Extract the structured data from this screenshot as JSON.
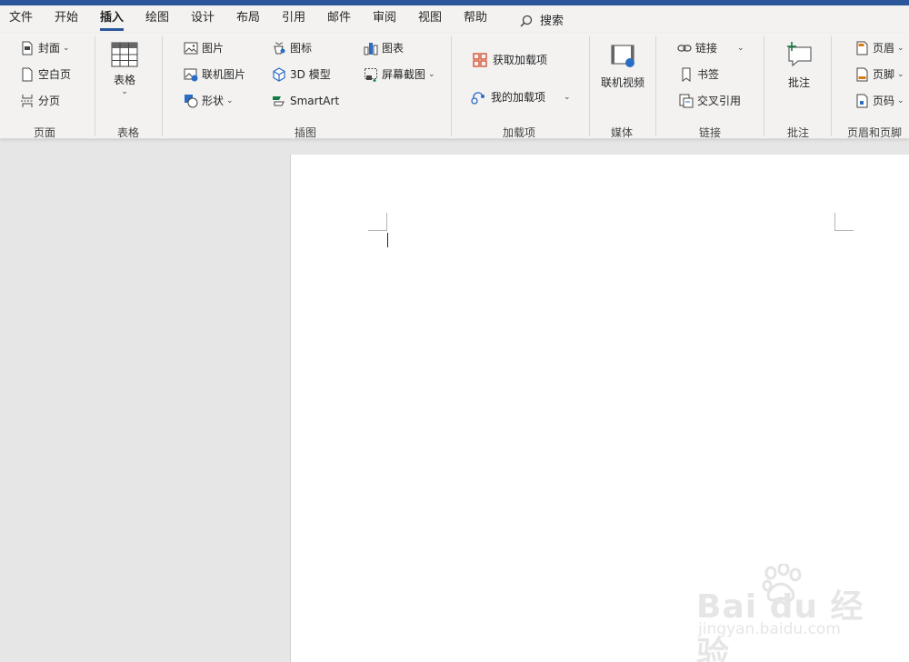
{
  "menu": {
    "tabs": [
      {
        "label": "文件"
      },
      {
        "label": "开始"
      },
      {
        "label": "插入"
      },
      {
        "label": "绘图"
      },
      {
        "label": "设计"
      },
      {
        "label": "布局"
      },
      {
        "label": "引用"
      },
      {
        "label": "邮件"
      },
      {
        "label": "审阅"
      },
      {
        "label": "视图"
      },
      {
        "label": "帮助"
      }
    ],
    "active_tab": "插入",
    "search_label": "搜索"
  },
  "ribbon": {
    "pages": {
      "group_label": "页面",
      "cover": "封面",
      "blank": "空白页",
      "break": "分页"
    },
    "tables": {
      "group_label": "表格",
      "table": "表格"
    },
    "illustrations": {
      "group_label": "插图",
      "pictures": "图片",
      "online_pictures": "联机图片",
      "shapes": "形状",
      "icons": "图标",
      "models_3d": "3D 模型",
      "smartart": "SmartArt",
      "chart": "图表",
      "screenshot": "屏幕截图"
    },
    "addins": {
      "group_label": "加载项",
      "get": "获取加载项",
      "my": "我的加载项"
    },
    "media": {
      "group_label": "媒体",
      "online_video": "联机视频"
    },
    "links": {
      "group_label": "链接",
      "link": "链接",
      "bookmark": "书签",
      "cross_ref": "交叉引用"
    },
    "comments": {
      "group_label": "批注",
      "comment": "批注"
    },
    "header_footer": {
      "group_label": "页眉和页脚",
      "header": "页眉",
      "footer": "页脚",
      "page_number": "页码"
    }
  },
  "watermark": {
    "brand": "Bai du 经验",
    "url": "jingyan.baidu.com"
  },
  "colors": {
    "accent": "#2b579a",
    "ribbon_bg": "#f3f2f1",
    "canvas_bg": "#e6e6e6",
    "addin_red": "#d24726",
    "green": "#107c41"
  }
}
